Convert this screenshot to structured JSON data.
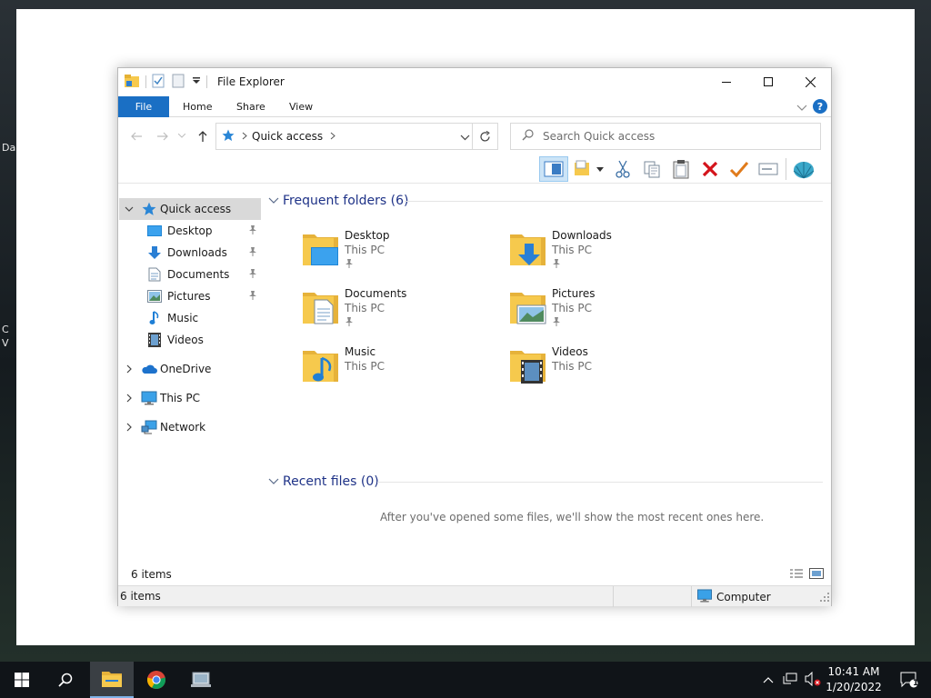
{
  "desktop": {
    "edge_fragments": [
      "Da",
      "C",
      "V"
    ]
  },
  "window": {
    "title": "File Explorer",
    "tabs": [
      {
        "id": "file",
        "label": "File"
      },
      {
        "id": "home",
        "label": "Home"
      },
      {
        "id": "share",
        "label": "Share"
      },
      {
        "id": "view",
        "label": "View"
      }
    ],
    "address": {
      "path": "Quick access"
    },
    "search": {
      "placeholder": "Search Quick access"
    },
    "nav": {
      "quick_access": "Quick access",
      "items": [
        {
          "label": "Desktop",
          "pinned": true
        },
        {
          "label": "Downloads",
          "pinned": true
        },
        {
          "label": "Documents",
          "pinned": true
        },
        {
          "label": "Pictures",
          "pinned": true
        },
        {
          "label": "Music",
          "pinned": false
        },
        {
          "label": "Videos",
          "pinned": false
        }
      ],
      "onedrive": "OneDrive",
      "this_pc": "This PC",
      "network": "Network"
    },
    "frequent": {
      "heading": "Frequent folders (6)",
      "folders": [
        {
          "name": "Desktop",
          "location": "This PC",
          "pinned": true
        },
        {
          "name": "Downloads",
          "location": "This PC",
          "pinned": true
        },
        {
          "name": "Documents",
          "location": "This PC",
          "pinned": true
        },
        {
          "name": "Pictures",
          "location": "This PC",
          "pinned": true
        },
        {
          "name": "Music",
          "location": "This PC",
          "pinned": false
        },
        {
          "name": "Videos",
          "location": "This PC",
          "pinned": false
        }
      ]
    },
    "recent": {
      "heading": "Recent files (0)",
      "empty_message": "After you've opened some files, we'll show the most recent ones here."
    },
    "item_count": "6 items",
    "status": {
      "left": "6 items",
      "right": "Computer"
    }
  },
  "taskbar": {
    "time": "10:41 AM",
    "date": "1/20/2022",
    "notification_count": "1"
  },
  "colors": {
    "accent": "#1a6fc4",
    "section_heading": "#1e3287",
    "folder": "#f6c94d",
    "delete_red": "#d4141b",
    "check_orange": "#e07b1c"
  }
}
